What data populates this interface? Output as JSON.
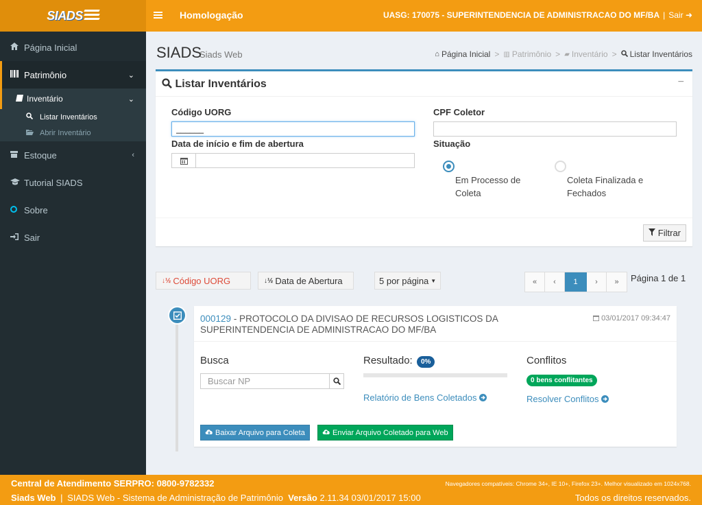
{
  "header": {
    "logo_text": "SIADS",
    "menu_toggle_icon": "bars-icon",
    "environment": "Homologação",
    "uasg": "UASG: 170075 - SUPERINTENDENCIA DE ADMINISTRACAO DO MF/BA",
    "separator": "|",
    "logout_label": "Sair"
  },
  "sidebar": {
    "items": [
      {
        "label": "Página Inicial",
        "icon": "home-icon"
      },
      {
        "label": "Patrimônio",
        "icon": "barcode-icon"
      },
      {
        "label": "Inventário",
        "icon": "book-icon"
      },
      {
        "label": "Listar Inventários",
        "icon": "search-icon"
      },
      {
        "label": "Abrir Inventário",
        "icon": "folder-open-icon"
      },
      {
        "label": "Estoque",
        "icon": "archive-icon"
      },
      {
        "label": "Tutorial SIADS",
        "icon": "graduation-cap-icon"
      },
      {
        "label": "Sobre",
        "icon": "circle-icon"
      },
      {
        "label": "Sair",
        "icon": "sign-in-icon"
      }
    ]
  },
  "content_header": {
    "title": "SIADS",
    "subtitle": "Siads Web",
    "breadcrumb": [
      "Página Inicial",
      "Patrimônio",
      "Inventário",
      "Listar Inventários"
    ]
  },
  "filter_box": {
    "title": "Listar Inventários",
    "collapse_label": "−",
    "codigo_uorg_label": "Código UORG",
    "codigo_uorg_value": "______",
    "cpf_coletor_label": "CPF Coletor",
    "cpf_coletor_value": "",
    "data_label": "Data de início e fim de abertura",
    "data_value": "",
    "situacao_label": "Situação",
    "situacao_options": [
      "Em Processo de Coleta",
      "Coleta Finalizada e Fechados"
    ],
    "situacao_selected": "Em Processo de Coleta",
    "filter_button": "Filtrar"
  },
  "toolbar": {
    "sort_uorg": "Código UORG",
    "sort_data": "Data de Abertura",
    "per_page": "5 por página",
    "pager": [
      "«",
      "‹",
      "1",
      "›",
      "»"
    ],
    "current_page": "1",
    "page_info": "Página 1 de 1"
  },
  "inventory": {
    "code": "000129",
    "description": " - PROTOCOLO DA DIVISAO DE RECURSOS LOGISTICOS DA SUPERINTENDENCIA DE ADMINISTRACAO DO MF/BA",
    "datetime": "03/01/2017 09:34:47",
    "busca_label": "Busca",
    "busca_placeholder": "Buscar NP",
    "resultado_label": "Resultado:",
    "resultado_badge": "0%",
    "progress": 0,
    "relatorio_link": "Relatório de Bens Coletados",
    "conflitos_label": "Conflitos",
    "conflitos_badge": "0 bens conflitantes",
    "resolver_link": "Resolver Conflitos",
    "download_button": "Baixar Arquivo para Coleta",
    "upload_button": "Enviar Arquivo Coletado para Web"
  },
  "footer": {
    "central": "Central de Atendimento SERPRO: 0800-9782332",
    "browsers": "Navegadores compatíveis: Chrome 34+, IE 10+, Firefox 23+. Melhor visualizado em 1024x768.",
    "app_name": "Siads Web",
    "separator": "|",
    "system_desc": "SIADS Web - Sistema de Administração de Patrimônio",
    "version_label": "Versão",
    "version_value": "2.11.34 03/01/2017 15:00",
    "rights": "Todos os direitos reservados."
  },
  "colors": {
    "brand_orange": "#f39c12",
    "sidebar_dark": "#222d32",
    "primary_blue": "#3c8dbc",
    "success_green": "#00a65a",
    "danger_red": "#dd4b39"
  }
}
